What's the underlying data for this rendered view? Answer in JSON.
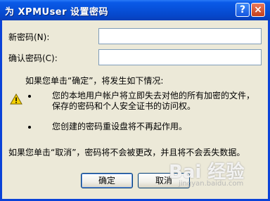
{
  "window": {
    "title": "为 XPMUser 设置密码",
    "help_label": "?",
    "close_label": "×"
  },
  "form": {
    "new_password_label": "新密码(N):",
    "confirm_password_label": "确认密码(C):",
    "new_password_value": "",
    "confirm_password_value": ""
  },
  "message": {
    "intro": "如果您单击“确定”，将发生如下情况:",
    "bullet1_line1": "您的本地用户帐户将立即失去对他的所有加密的文件，",
    "bullet1_line2": "保存的密码和个人安全证书的访问权。",
    "bullet2": "您创建的密码重设盘将不再起作用。",
    "cancel_note": "如果您单击“取消”，密码将不会被更改，并且将不会丢失数据。"
  },
  "buttons": {
    "ok_label": "确定",
    "cancel_label": "取消"
  },
  "watermark": {
    "text": "Bai 经验",
    "url": "jingyan.baidu.com"
  }
}
